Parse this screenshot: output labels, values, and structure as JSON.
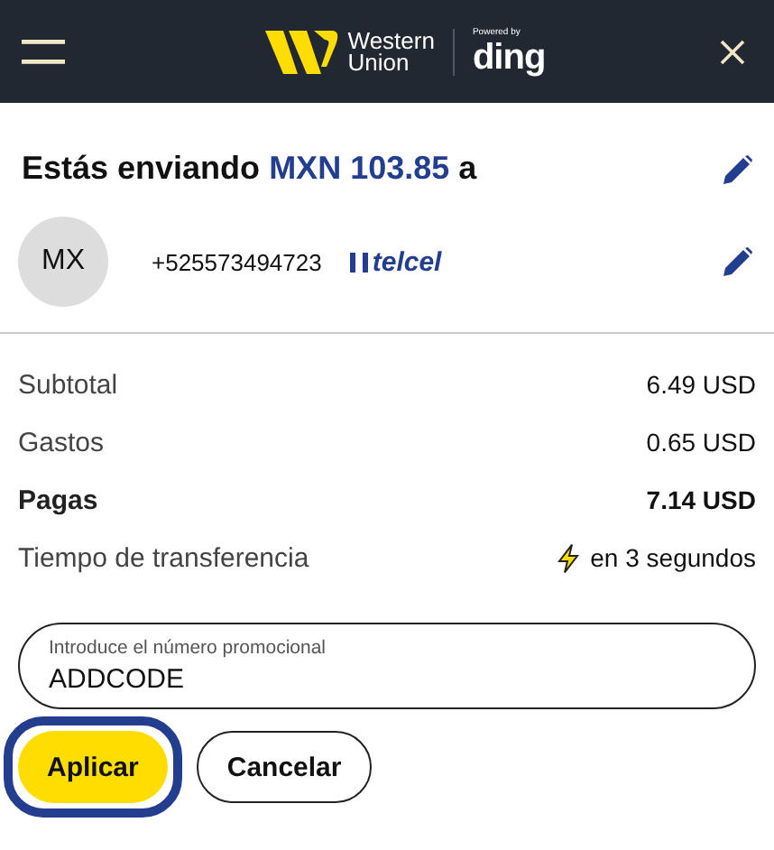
{
  "header": {
    "brand_line_1": "Western",
    "brand_line_2": "Union",
    "powered_by": "Powered by",
    "partner": "ding"
  },
  "title": {
    "prefix": "Estás enviando",
    "amount": "MXN 103.85",
    "suffix": "a"
  },
  "recipient": {
    "avatar": "MX",
    "phone": "+525573494723",
    "carrier": "telcel"
  },
  "summary": [
    {
      "kind": "text",
      "label": "Subtotal",
      "value": "6.49 USD",
      "emphasis": false
    },
    {
      "kind": "text",
      "label": "Gastos",
      "value": "0.65 USD",
      "emphasis": false
    },
    {
      "kind": "text",
      "label": "Pagas",
      "value": "7.14 USD",
      "emphasis": true
    },
    {
      "kind": "time",
      "label": "Tiempo de transferencia",
      "value": "en 3 segundos",
      "emphasis": false
    }
  ],
  "promo": {
    "label": "Introduce el número promocional",
    "value": "ADDCODE"
  },
  "buttons": [
    {
      "kind": "primary",
      "label": "Aplicar",
      "focused": true
    },
    {
      "kind": "secondary",
      "label": "Cancelar",
      "focused": false
    }
  ]
}
